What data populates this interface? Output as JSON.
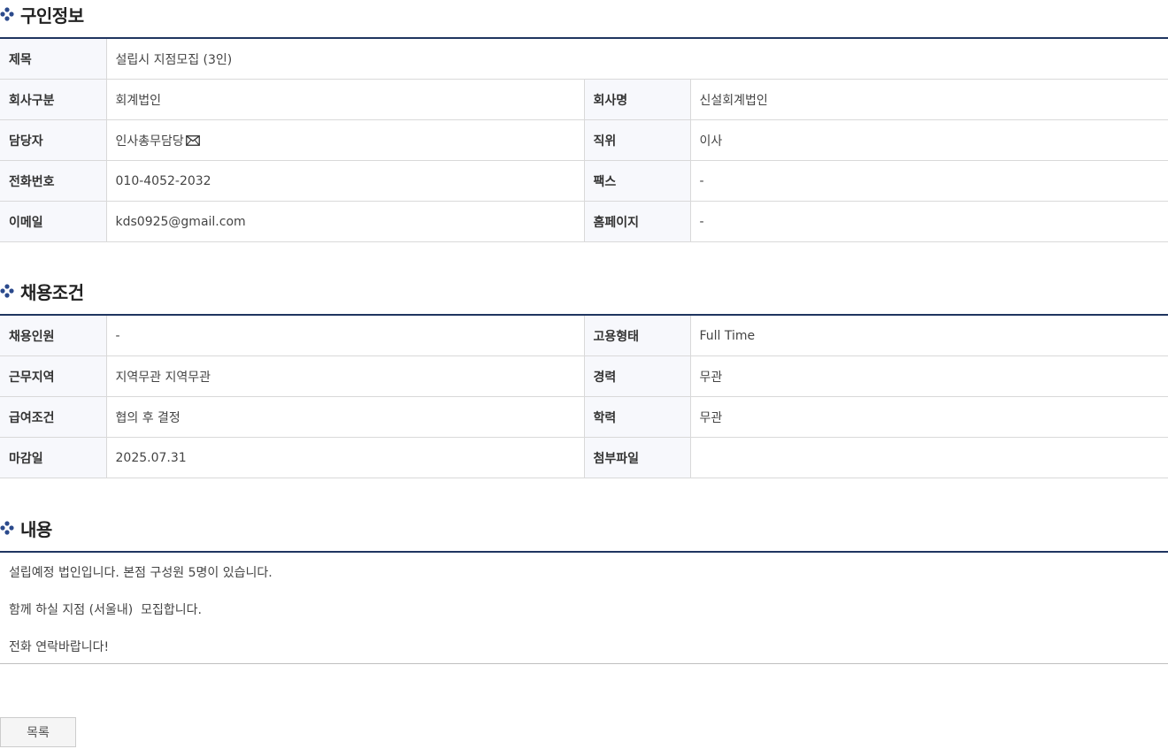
{
  "recruit_info": {
    "title": "구인정보",
    "rows": [
      {
        "label": "제목",
        "value": "설립시 지점모집 (3인)"
      },
      {
        "label1": "회사구분",
        "value1": "회계법인",
        "label2": "회사명",
        "value2": "신설회계법인"
      },
      {
        "label1": "담당자",
        "value1": "인사총무담당",
        "label2": "직위",
        "value2": "이사"
      },
      {
        "label1": "전화번호",
        "value1": "010-4052-2032",
        "label2": "팩스",
        "value2": "-"
      },
      {
        "label1": "이메일",
        "value1": "kds0925@gmail.com",
        "label2": "홈페이지",
        "value2": "-"
      }
    ],
    "contact_icon": "mail-icon"
  },
  "conditions": {
    "title": "채용조건",
    "rows": [
      {
        "label1": "채용인원",
        "value1": "-",
        "label2": "고용형태",
        "value2": "Full Time"
      },
      {
        "label1": "근무지역",
        "value1": "지역무관 지역무관",
        "label2": "경력",
        "value2": "무관"
      },
      {
        "label1": "급여조건",
        "value1": "협의 후 결정",
        "label2": "학력",
        "value2": "무관"
      },
      {
        "label1": "마감일",
        "value1": "2025.07.31",
        "label2": "첨부파일",
        "value2": ""
      }
    ]
  },
  "content": {
    "title": "내용",
    "lines": [
      "설립예정 법인입니다. 본점 구성원 5명이 있습니다.",
      "함께 하실 지점 (서울내)  모집합니다.",
      "전화 연락바랍니다!"
    ]
  },
  "actions": {
    "list_label": "목록"
  },
  "colors": {
    "accent": "#1f3560",
    "icon": "#2b4a8c",
    "label_bg": "#f7f8fc",
    "border": "#d9d9d9"
  }
}
